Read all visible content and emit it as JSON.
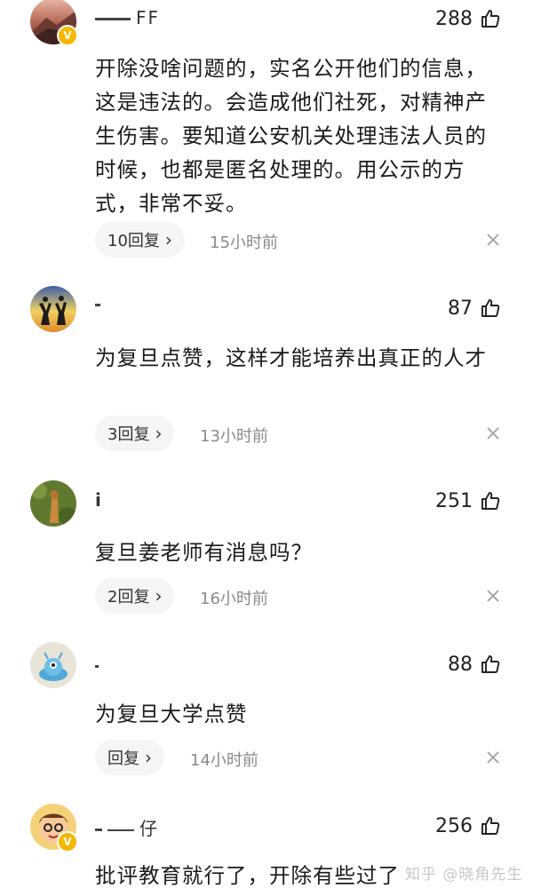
{
  "comments": [
    {
      "username": "FF",
      "likes": "288",
      "text": "开除没啥问题的，实名公开他们的信息，这是违法的。会造成他们社死，对精神产生伤害。要知道公安机关处理违法人员的时候，也都是匿名处理的。用公示的方式，非常不妥。",
      "replies": "10回复",
      "time": "15小时前",
      "verified": true
    },
    {
      "username": "",
      "likes": "87",
      "text": "为复旦点赞，这样才能培养出真正的人才",
      "replies": "3回复",
      "time": "13小时前",
      "verified": false
    },
    {
      "username": "i",
      "likes": "251",
      "text": "复旦姜老师有消息吗？",
      "replies": "2回复",
      "time": "16小时前",
      "verified": false
    },
    {
      "username": "",
      "likes": "88",
      "text": "为复旦大学点赞",
      "replies": "回复",
      "time": "14小时前",
      "verified": false
    },
    {
      "username": "仔",
      "likes": "256",
      "text": "批评教育就行了，开除有些过了",
      "replies": "",
      "time": "",
      "verified": true
    }
  ],
  "watermark": "知乎 @晓角先生",
  "icons": {
    "like": "thumbs-up-icon",
    "close": "close-icon",
    "chevron": "chevron-right-icon",
    "verified": "verified-badge-icon"
  },
  "colors": {
    "pill_bg": "#f4f5f7",
    "time_gray": "#8a8a8a",
    "badge_gold": "#f5b700"
  }
}
